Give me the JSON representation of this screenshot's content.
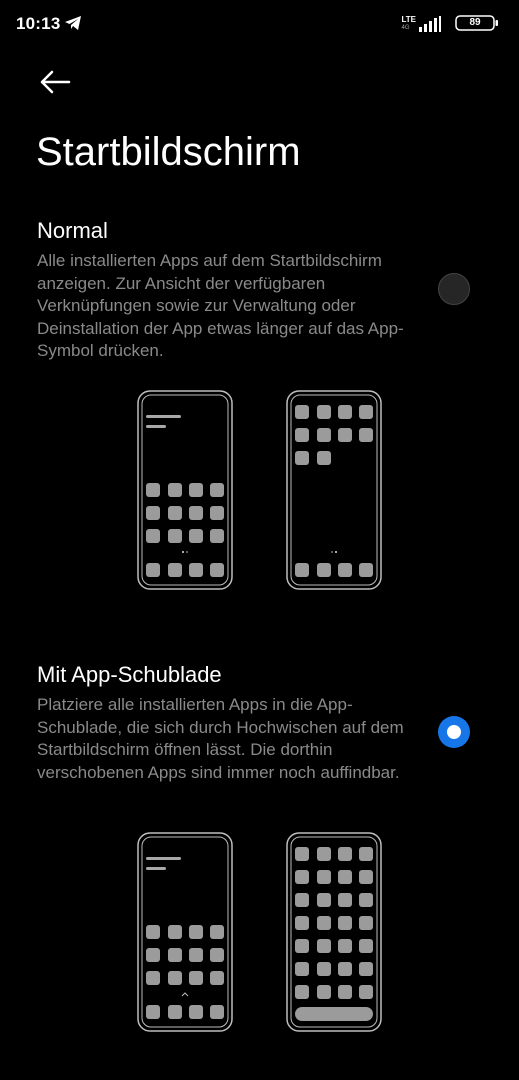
{
  "status_bar": {
    "time": "10:13",
    "network": "LTE",
    "network_sub": "4G",
    "battery": "89"
  },
  "page": {
    "title": "Startbildschirm"
  },
  "options": [
    {
      "title": "Normal",
      "description": "Alle installierten Apps auf dem Startbildschirm anzeigen. Zur Ansicht der verfügbaren Verknüpfungen sowie zur Verwaltung oder Deinstallation der App etwas länger auf das App-Symbol drücken.",
      "selected": false
    },
    {
      "title": "Mit App-Schublade",
      "description": "Platziere alle installierten Apps in die App-Schublade, die sich durch Hochwischen auf dem Startbildschirm öffnen lässt. Die dorthin verschobenen Apps sind immer noch auffindbar.",
      "selected": true
    }
  ],
  "colors": {
    "accent": "#1676e8",
    "background": "#000000",
    "secondary_text": "#8a8a8a"
  },
  "icons": [
    "back-arrow-icon",
    "telegram-icon",
    "signal-icon",
    "battery-icon"
  ]
}
